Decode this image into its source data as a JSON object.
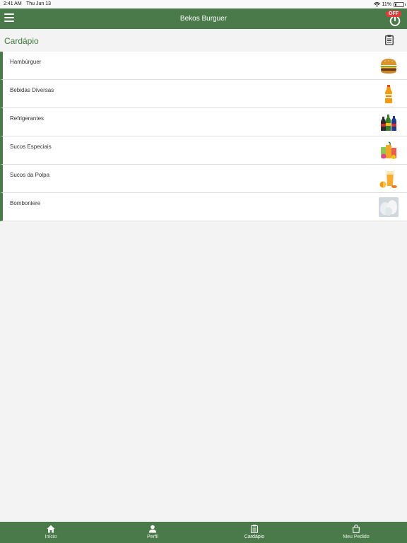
{
  "status": {
    "time": "2:41 AM",
    "date": "Thu Jun 13",
    "battery": "11%"
  },
  "header": {
    "title": "Bekos Burguer",
    "status_badge": "OFF"
  },
  "section": {
    "title": "Cardápio"
  },
  "categories": [
    {
      "label": "Hambúrguer",
      "icon": "burger-icon"
    },
    {
      "label": "Bebidas Diversas",
      "icon": "juice-bottle-icon"
    },
    {
      "label": "Refrigerantes",
      "icon": "soda-bottles-icon"
    },
    {
      "label": "Sucos Especiais",
      "icon": "fruit-juices-icon"
    },
    {
      "label": "Sucos da Polpa",
      "icon": "orange-juice-icon"
    },
    {
      "label": "Bomboniere",
      "icon": "sweets-icon"
    }
  ],
  "nav": [
    {
      "label": "Início",
      "icon": "home-icon"
    },
    {
      "label": "Perfil",
      "icon": "person-icon"
    },
    {
      "label": "Cardápio",
      "icon": "clipboard-icon",
      "active": true
    },
    {
      "label": "Meu Pedido",
      "icon": "shopping-bag-icon"
    }
  ],
  "colors": {
    "primary": "#4a7a4a",
    "section_title": "#3d7a3d",
    "badge": "#e23b3b",
    "background": "#f3f3f3"
  }
}
